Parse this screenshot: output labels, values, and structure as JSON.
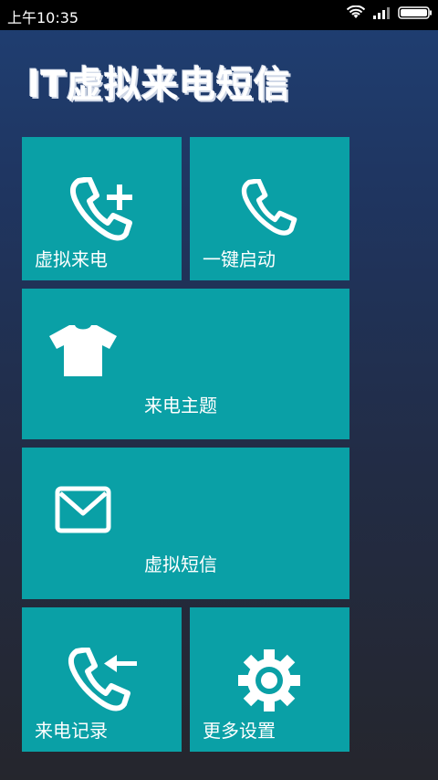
{
  "status": {
    "time": "上午10:35",
    "icons": [
      "wifi-icon",
      "signal-icon",
      "battery-icon"
    ]
  },
  "app": {
    "title": "lT虚拟来电短信"
  },
  "tiles": {
    "virtual_call": {
      "label": "虚拟来电",
      "icon": "phone-add-icon"
    },
    "one_key_start": {
      "label": "一键启动",
      "icon": "phone-icon"
    },
    "call_theme": {
      "label": "来电主题",
      "icon": "tshirt-icon"
    },
    "virtual_sms": {
      "label": "虚拟短信",
      "icon": "envelope-icon"
    },
    "call_log": {
      "label": "来电记录",
      "icon": "phone-incoming-icon"
    },
    "more_settings": {
      "label": "更多设置",
      "icon": "gear-icon"
    }
  },
  "colors": {
    "tile": "#0aa0a6",
    "status_bar": "#000000"
  }
}
